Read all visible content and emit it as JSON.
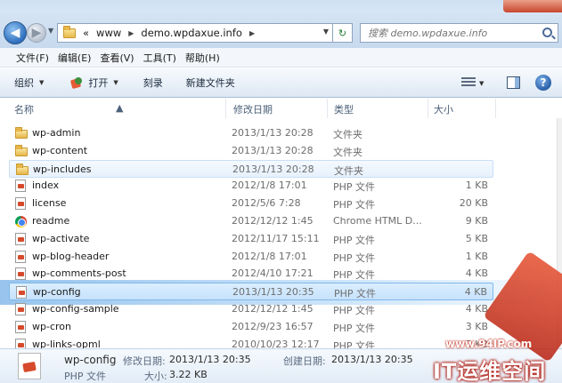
{
  "address": {
    "segments": [
      "«",
      "www",
      "demo.wpdaxue.info"
    ],
    "search_placeholder": "搜索 demo.wpdaxue.info"
  },
  "menu": [
    "文件(F)",
    "编辑(E)",
    "查看(V)",
    "工具(T)",
    "帮助(H)"
  ],
  "toolbar": {
    "organize": "组织",
    "open": "打开",
    "burn": "刻录",
    "new_folder": "新建文件夹"
  },
  "columns": {
    "name": "名称",
    "date": "修改日期",
    "type": "类型",
    "size": "大小"
  },
  "files": [
    {
      "name": "wp-admin",
      "date": "2013/1/13 20:28",
      "type": "文件夹",
      "size": "",
      "icon": "folder-icon"
    },
    {
      "name": "wp-content",
      "date": "2013/1/13 20:28",
      "type": "文件夹",
      "size": "",
      "icon": "folder-icon"
    },
    {
      "name": "wp-includes",
      "date": "2013/1/13 20:28",
      "type": "文件夹",
      "size": "",
      "icon": "folder-icon",
      "state": "hover"
    },
    {
      "name": "index",
      "date": "2012/1/8 17:01",
      "type": "PHP 文件",
      "size": "1 KB",
      "icon": "php-file-icon"
    },
    {
      "name": "license",
      "date": "2012/5/6 7:28",
      "type": "PHP 文件",
      "size": "20 KB",
      "icon": "php-file-icon"
    },
    {
      "name": "readme",
      "date": "2012/12/12 1:45",
      "type": "Chrome HTML D...",
      "size": "9 KB",
      "icon": "chrome-icon"
    },
    {
      "name": "wp-activate",
      "date": "2012/11/17 15:11",
      "type": "PHP 文件",
      "size": "5 KB",
      "icon": "php-file-icon"
    },
    {
      "name": "wp-blog-header",
      "date": "2012/1/8 17:01",
      "type": "PHP 文件",
      "size": "1 KB",
      "icon": "php-file-icon"
    },
    {
      "name": "wp-comments-post",
      "date": "2012/4/10 17:21",
      "type": "PHP 文件",
      "size": "4 KB",
      "icon": "php-file-icon"
    },
    {
      "name": "wp-config",
      "date": "2013/1/13 20:35",
      "type": "PHP 文件",
      "size": "4 KB",
      "icon": "php-file-icon",
      "state": "selected"
    },
    {
      "name": "wp-config-sample",
      "date": "2012/12/12 1:45",
      "type": "PHP 文件",
      "size": "4 KB",
      "icon": "php-file-icon"
    },
    {
      "name": "wp-cron",
      "date": "2012/9/23 16:57",
      "type": "PHP 文件",
      "size": "3 KB",
      "icon": "php-file-icon"
    },
    {
      "name": "wp-links-opml",
      "date": "2010/10/23 12:17",
      "type": "PHP 文件",
      "size": "3 KB",
      "icon": "php-file-icon"
    }
  ],
  "details": {
    "name": "wp-config",
    "modified_label": "修改日期:",
    "modified": "2013/1/13 20:35",
    "created_label": "创建日期:",
    "created": "2013/1/13 20:35",
    "type": "PHP 文件",
    "size_label": "大小:",
    "size": "3.22 KB"
  },
  "watermark": {
    "url": "www.94IP.com",
    "logo": "IT运维空间"
  }
}
